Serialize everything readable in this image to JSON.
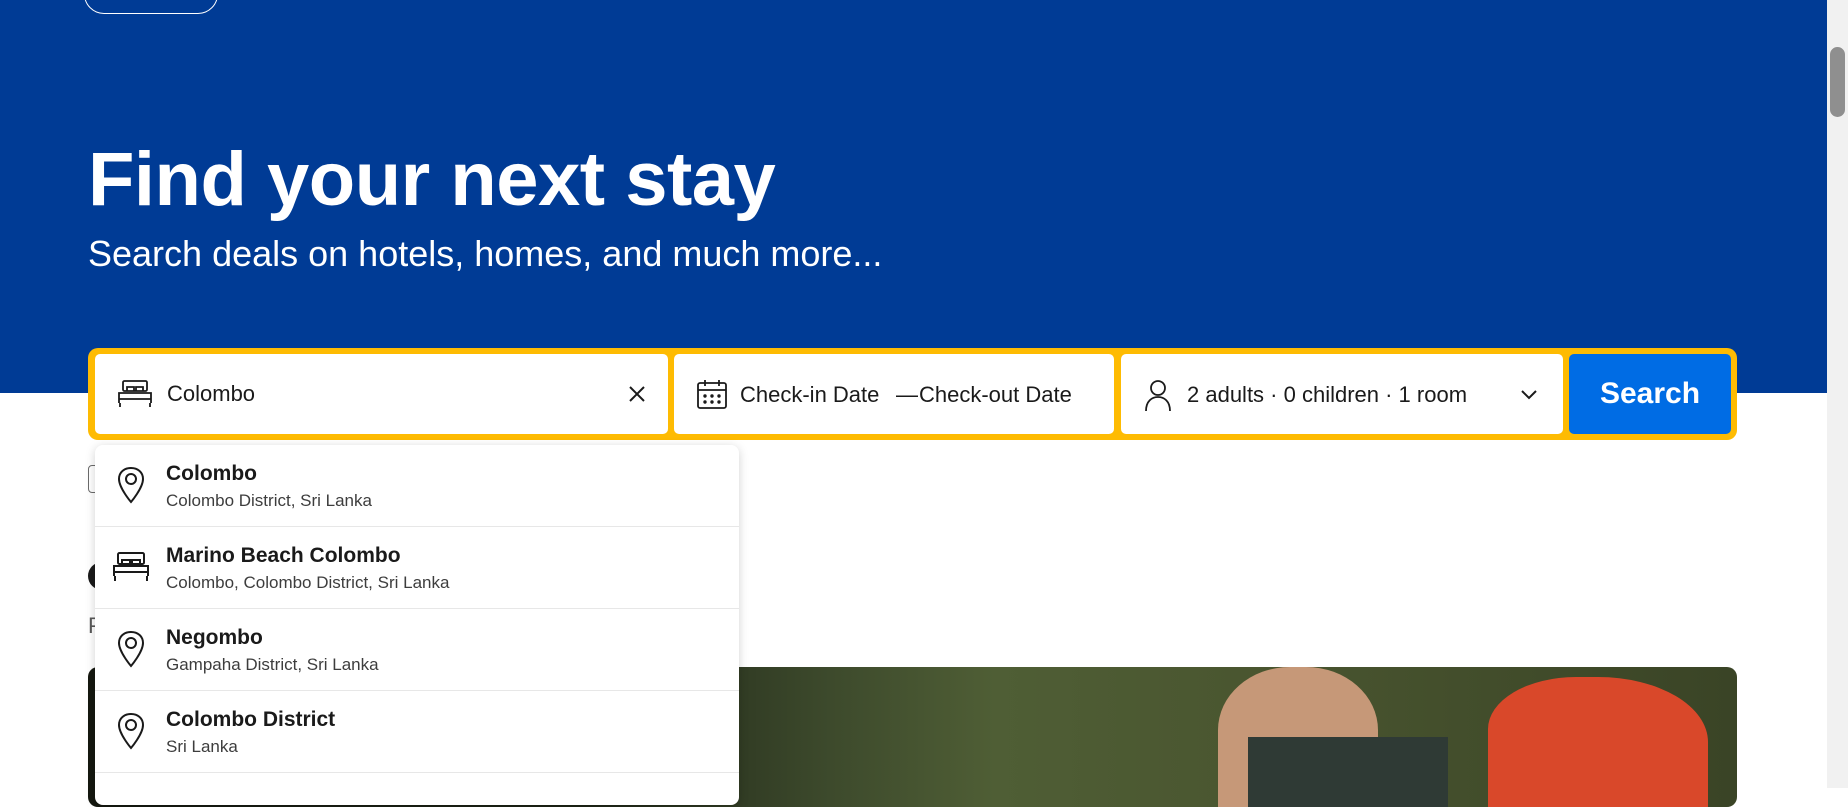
{
  "hero": {
    "title": "Find your next stay",
    "subtitle": "Search deals on hotels, homes, and much more..."
  },
  "search": {
    "destination_value": "Colombo",
    "checkin_label": "Check-in Date",
    "date_separator": "—",
    "checkout_label": "Check-out Date",
    "guests_summary": "2 adults · 0 children · 1 room",
    "search_button": "Search"
  },
  "suggestions": [
    {
      "title": "Colombo",
      "subtitle": "Colombo District, Sri Lanka",
      "icon": "map-pin-icon"
    },
    {
      "title": "Marino Beach Colombo",
      "subtitle": "Colombo, Colombo District, Sri Lanka",
      "icon": "bed-icon"
    },
    {
      "title": "Negombo",
      "subtitle": "Gampaha District, Sri Lanka",
      "icon": "map-pin-icon"
    },
    {
      "title": "Colombo District",
      "subtitle": "Sri Lanka",
      "icon": "map-pin-icon"
    }
  ],
  "colors": {
    "hero_bg": "#003b95",
    "search_border": "#febb02",
    "search_button": "#006ce4"
  }
}
